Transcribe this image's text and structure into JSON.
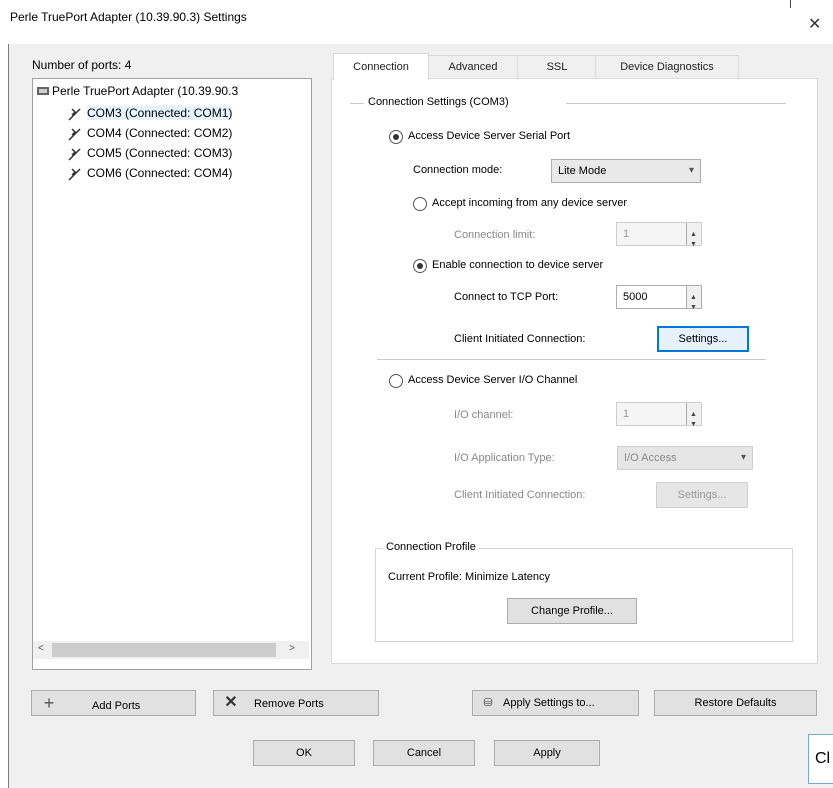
{
  "window": {
    "title": "Perle TruePort Adapter (10.39.90.3) Settings",
    "close": "✕"
  },
  "left": {
    "label": "Number of ports: 4",
    "root": "Perle TruePort Adapter (10.39.90.3",
    "ports": [
      {
        "name": "COM3 (Connected: COM1)"
      },
      {
        "name": "COM4 (Connected: COM2)"
      },
      {
        "name": "COM5 (Connected: COM3)"
      },
      {
        "name": "COM6 (Connected: COM4)"
      }
    ],
    "scroll_left": "<",
    "scroll_right": ">"
  },
  "tabs": [
    "Connection",
    "Advanced",
    "SSL",
    "Device Diagnostics"
  ],
  "connection": {
    "group_title": "Connection Settings (COM3)",
    "option1": {
      "label": "Access Device Server Serial Port",
      "selected": true
    },
    "connection_mode_label": "Connection mode:",
    "connection_mode_value": "Lite Mode",
    "sub_option_a": {
      "label": "Accept incoming from any device server",
      "selected": false
    },
    "connection_limit_label": "Connection limit:",
    "connection_limit_value": "1",
    "sub_option_b": {
      "label": "Enable connection to device server",
      "selected": true
    },
    "tcp_port_label": "Connect to TCP Port:",
    "tcp_port_value": "5000",
    "client_settings_label": "Client Initiated Connection:",
    "settings_button": "Settings...",
    "option2": {
      "label": "Access Device Server I/O Channel",
      "selected": false
    },
    "io_channel_label": "I/O channel:",
    "io_channel_value": "1",
    "io_app_type_label": "I/O Application Type:",
    "io_app_type_value": "I/O Access",
    "io_client_label": "Client Initiated Connection:",
    "io_settings_button": "Settings..."
  },
  "profile": {
    "group_title": "Connection Profile",
    "current_label": "Current Profile: Minimize Latency",
    "change_button": "Change Profile..."
  },
  "bottom": {
    "add_port": "Add Ports",
    "remove_port": "Remove Ports",
    "apply_settings": "Apply Settings to...",
    "restore_defaults": "Restore Defaults",
    "ok": "OK",
    "cancel": "Cancel",
    "apply": "Apply"
  },
  "overlay_badge": "Cl",
  "colors": {
    "focus": "#0078d7",
    "window_bg": "#f0f0f0"
  }
}
